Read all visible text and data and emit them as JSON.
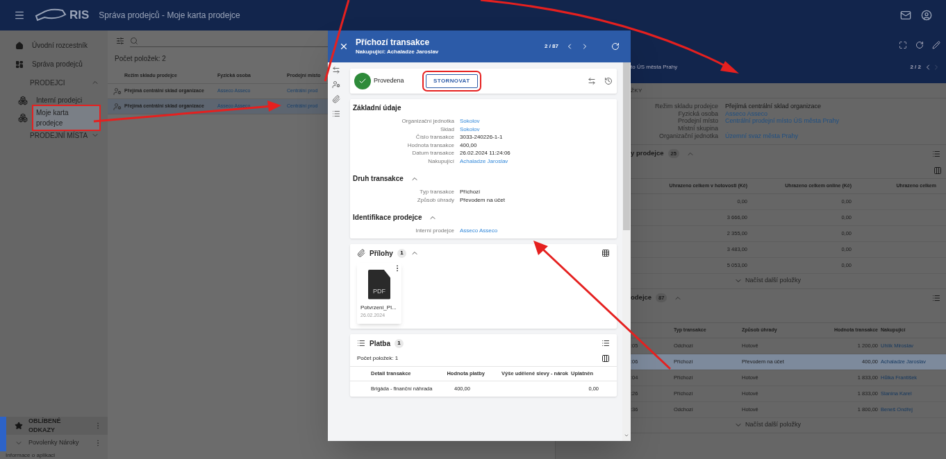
{
  "header": {
    "logo": "RIS",
    "title": "Správa prodejců - Moje karta prodejce"
  },
  "sidebar": {
    "items": [
      {
        "kind": "link",
        "label": "Úvodní rozcestník"
      },
      {
        "kind": "link",
        "label": "Správa prodejců"
      },
      {
        "kind": "section",
        "label": "PRODEJCI",
        "expanded": true
      },
      {
        "kind": "subitem",
        "label": "Interní prodejci",
        "selected": false
      },
      {
        "kind": "subitem",
        "label": "Moje karta prodejce",
        "selected": true
      },
      {
        "kind": "section",
        "label": "PRODEJNÍ MÍSTA",
        "expanded": false
      }
    ],
    "favorites": {
      "title": "OBLÍBENÉ ODKAZY",
      "items": [
        {
          "label": "Povolenky Nároky",
          "expanded": false
        }
      ]
    },
    "footer": "Informace o aplikaci"
  },
  "list": {
    "count": "Počet položek: 2",
    "columns": [
      "Režim skladu prodejce",
      "Fyzická osoba",
      "Prodejní místo"
    ],
    "rows": [
      {
        "selected": false,
        "cells": [
          "Přejímá centrální sklad organizace",
          "Asseco Asseco",
          "Centrální prod"
        ]
      },
      {
        "selected": true,
        "cells": [
          "Přejímá centrální sklad organizace",
          "Asseco Asseco",
          "Centrální prod"
        ]
      }
    ]
  },
  "dialog": {
    "title": "Příchozí transakce",
    "subtitle": "Nakupující: Achaladze Jaroslav",
    "pager": "2 / 87",
    "status": "Provedena",
    "action": "STORNOVAT",
    "sections": [
      {
        "title": "Základní údaje",
        "fields": [
          {
            "label": "Organizační jednotka",
            "value": "Sokolov",
            "link": true
          },
          {
            "label": "Sklad",
            "value": "Sokolov",
            "link": true
          },
          {
            "label": "Číslo transakce",
            "value": "3033-240226-1-1",
            "link": false
          },
          {
            "label": "Hodnota transakce",
            "value": "400,00",
            "link": false
          },
          {
            "label": "Datum transakce",
            "value": "26.02.2024 11:24:06",
            "link": false
          },
          {
            "label": "Nakupující",
            "value": "Achaladze Jaroslav",
            "link": true
          }
        ]
      },
      {
        "title": "Druh transakce",
        "expanded": true,
        "fields": [
          {
            "label": "Typ transakce",
            "value": "Příchozí",
            "link": false
          },
          {
            "label": "Způsob úhrady",
            "value": "Převodem na účet",
            "link": false
          }
        ]
      },
      {
        "title": "Identifikace prodejce",
        "expanded": true,
        "fields": [
          {
            "label": "Interní prodejce",
            "value": "Asseco Asseco",
            "link": true
          }
        ]
      }
    ],
    "attachments": {
      "title": "Přílohy",
      "count": "1",
      "expanded": true,
      "files": [
        {
          "type": "PDF",
          "name": "Potvrzeni_Pl...",
          "date": "26.02.2024"
        }
      ]
    },
    "payments": {
      "title": "Platba",
      "count": "1",
      "total": "Počet položek: 1",
      "columns": [
        "Detail transakce",
        "Hodnota platby",
        "Výše udělené slevy - nárok",
        "Uplatněn"
      ],
      "rows": [
        [
          "Brigáda - finanční náhrada",
          "400,00",
          "0,00"
        ]
      ]
    }
  },
  "detail": {
    "subtitle": "to ÚS města Prahy",
    "pager": "2 / 2",
    "section": "ŽKY",
    "fields": [
      {
        "label": "Režim skladu prodejce",
        "value": "Přejímá centrální sklad organizace",
        "link": false
      },
      {
        "label": "Fyzická osoba",
        "value": "Asseco Asseco",
        "link": true
      },
      {
        "label": "Prodejní místo",
        "value": "Centrální prodejní místo ÚS města Prahy",
        "link": true
      },
      {
        "label": "Místní skupina"
      },
      {
        "label": "Organizační jednotka",
        "value": "Územní svaz města Prahy",
        "link": true
      }
    ],
    "tables": [
      {
        "title": "y prodejce",
        "count": "25",
        "expanded": true,
        "columns": [
          "Uhrazeno celkem v hotovosti (Kč)",
          "Uhrazeno celkem online (Kč)",
          "Uhrazeno celkem"
        ],
        "more": "Načíst další položky",
        "rows": [
          {
            "selected": false,
            "cells": [
              "0,00",
              "0,00"
            ]
          },
          {
            "selected": false,
            "cells": [
              "3 666,00",
              "0,00"
            ]
          },
          {
            "selected": false,
            "cells": [
              "2 355,00",
              "0,00"
            ]
          },
          {
            "selected": false,
            "cells": [
              "3 483,00",
              "0,00"
            ]
          },
          {
            "selected": false,
            "cells": [
              "5 053,00",
              "0,00"
            ]
          }
        ]
      },
      {
        "title": "odejce",
        "count": "87",
        "expanded": true,
        "columns": [
          "",
          "Typ transakce",
          "Způsob úhrady",
          "Hodnota transakce",
          "Nakupující"
        ],
        "more": "Načíst další položky",
        "rows": [
          {
            "selected": false,
            "cells": [
              ":05",
              "Odchozí",
              "Hotově",
              "1 200,00",
              "Uhlík Miroslav"
            ]
          },
          {
            "selected": true,
            "cells": [
              ":06",
              "Příchozí",
              "Převodem na účet",
              "400,00",
              "Achaladze Jaroslav"
            ]
          },
          {
            "selected": false,
            "cells": [
              ":04",
              "Příchozí",
              "Hotově",
              "1 833,00",
              "Hůlka František"
            ]
          },
          {
            "selected": false,
            "cells": [
              ":26",
              "Příchozí",
              "Hotově",
              "1 833,00",
              "Slanina Karel"
            ]
          },
          {
            "selected": false,
            "cells": [
              ":36",
              "Odchozí",
              "Hotově",
              "1 800,00",
              "Beneš Ondřej"
            ]
          }
        ]
      }
    ]
  }
}
